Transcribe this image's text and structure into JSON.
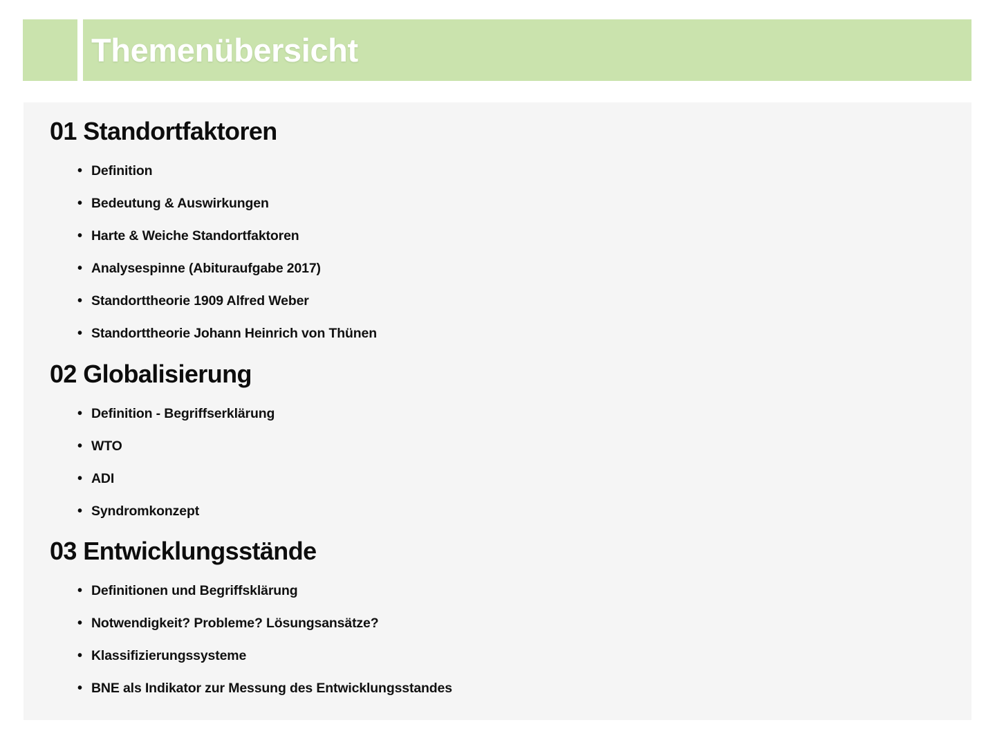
{
  "header": {
    "title": "Themenübersicht",
    "band_color": "#cae3ad",
    "title_color": "#ffffff",
    "divider_color": "#ffffff"
  },
  "panel": {
    "background_color": "#f5f5f5",
    "text_color": "#101010",
    "bullet_marker": "•"
  },
  "sections": [
    {
      "number": "01",
      "title": "01 Standortfaktoren",
      "items": [
        "Definition",
        "Bedeutung & Auswirkungen",
        "Harte & Weiche Standortfaktoren",
        "Analysespinne (Abituraufgabe 2017)",
        "Standorttheorie 1909 Alfred Weber",
        "Standorttheorie Johann Heinrich von Thünen"
      ]
    },
    {
      "number": "02",
      "title": "02 Globalisierung",
      "items": [
        "Definition - Begriffserklärung",
        "WTO",
        "ADI",
        "Syndromkonzept"
      ]
    },
    {
      "number": "03",
      "title": "03 Entwicklungsstände",
      "items": [
        "Definitionen und Begriffsklärung",
        "Notwendigkeit? Probleme? Lösungsansätze?",
        "Klassifizierungssysteme",
        "BNE als Indikator zur Messung des Entwicklungsstandes"
      ]
    }
  ]
}
